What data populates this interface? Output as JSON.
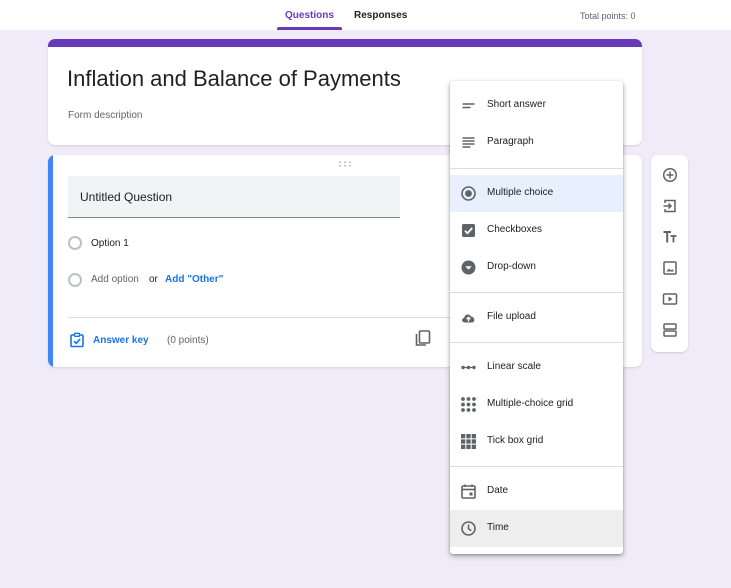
{
  "header": {
    "tabs": [
      {
        "label": "Questions",
        "active": true
      },
      {
        "label": "Responses",
        "active": false
      }
    ],
    "total_points": "Total points: 0"
  },
  "form": {
    "title": "Inflation and Balance of Payments",
    "description_placeholder": "Form description"
  },
  "question": {
    "title": "Untitled Question",
    "option_1": "Option 1",
    "add_option": "Add option",
    "or": "or",
    "add_other": "Add \"Other\"",
    "answer_key": "Answer key",
    "points": "(0 points)"
  },
  "toolbar": {
    "items": [
      {
        "name": "add-question-icon"
      },
      {
        "name": "import-questions-icon"
      },
      {
        "name": "add-title-description-icon"
      },
      {
        "name": "add-image-icon"
      },
      {
        "name": "add-video-icon"
      },
      {
        "name": "add-section-icon"
      }
    ]
  },
  "menu": {
    "items": [
      {
        "label": "Short answer",
        "icon": "short-answer-icon"
      },
      {
        "label": "Paragraph",
        "icon": "paragraph-icon"
      },
      {
        "label": "Multiple choice",
        "icon": "radio-button-icon",
        "selected": true
      },
      {
        "label": "Checkboxes",
        "icon": "checkbox-icon"
      },
      {
        "label": "Drop-down",
        "icon": "dropdown-icon"
      },
      {
        "label": "File upload",
        "icon": "cloud-upload-icon"
      },
      {
        "label": "Linear scale",
        "icon": "linear-scale-icon"
      },
      {
        "label": "Multiple-choice grid",
        "icon": "grid-dots-icon"
      },
      {
        "label": "Tick box grid",
        "icon": "grid-squares-icon"
      },
      {
        "label": "Date",
        "icon": "calendar-icon"
      },
      {
        "label": "Time",
        "icon": "clock-icon",
        "hovered": true
      }
    ]
  },
  "colors": {
    "accent": "#673ab7",
    "question_accent": "#4285f4",
    "link": "#1a73e8",
    "background": "#f0ebf8"
  }
}
